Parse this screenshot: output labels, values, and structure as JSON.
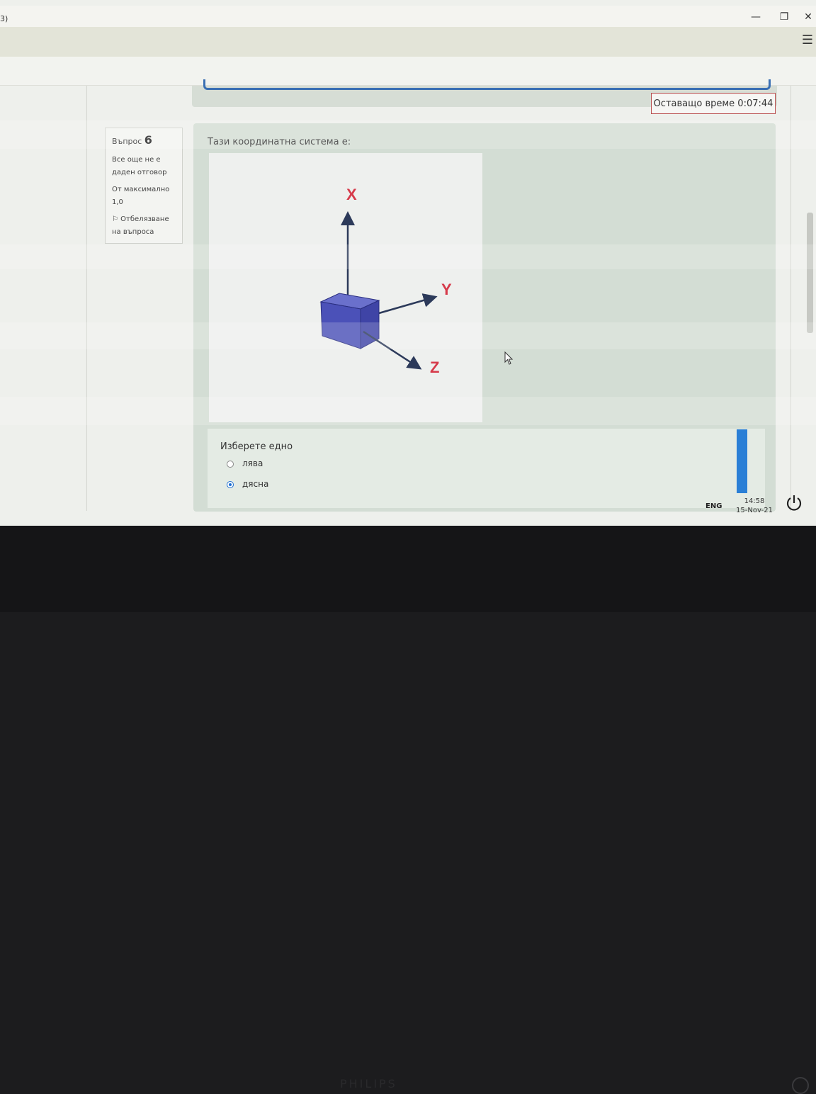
{
  "window": {
    "title_fragment": "3)",
    "minimize_glyph": "—",
    "maximize_glyph": "❐",
    "close_glyph": "✕",
    "menu_glyph": "☰"
  },
  "timer": {
    "text": "Оставащо време 0:07:44"
  },
  "question_info": {
    "label": "Въпрос",
    "number": "6",
    "status": "Все още не е даден отговор",
    "max_mark": "От максимално 1,0",
    "flag_label": "Отбелязване на въпроса"
  },
  "question": {
    "text": "Тази координатна система е:",
    "image": {
      "axis_x": "X",
      "axis_y": "Y",
      "axis_z": "Z",
      "cube_color": "#4b51b8",
      "label_color": "#d63a4a"
    }
  },
  "answer": {
    "prompt": "Изберете едно",
    "options": [
      {
        "label": "лява",
        "selected": false
      },
      {
        "label": "дясна",
        "selected": true
      }
    ]
  },
  "taskbar": {
    "lang": "ENG",
    "time": "14:58",
    "date": "15-Nov-21"
  },
  "monitor": {
    "brand": "PHILIPS"
  }
}
